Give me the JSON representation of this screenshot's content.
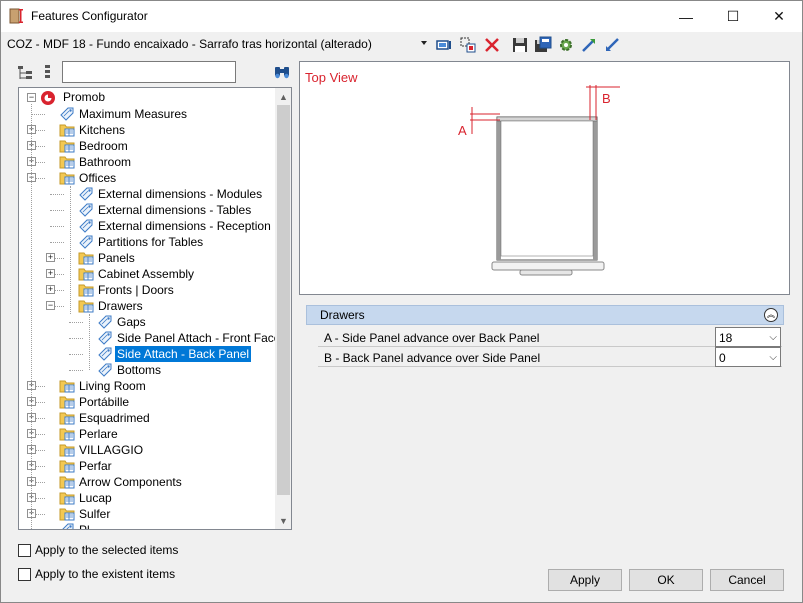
{
  "window": {
    "title": "Features Configurator",
    "minimize_glyph": "—",
    "maximize_glyph": "☐",
    "close_glyph": "✕"
  },
  "toolbar": {
    "config_value": "COZ - MDF 18 - Fundo encaixado - Sarrafo tras horizontal (alterado)",
    "icons": [
      "select-screen-icon",
      "select-item-icon",
      "delete-icon",
      "save-icon",
      "save-as-icon",
      "settings-icon",
      "expand-icon",
      "collapse-icon"
    ]
  },
  "search": {
    "value": "",
    "placeholder": ""
  },
  "tree": {
    "root": "Promob",
    "items": [
      {
        "label": "Maximum Measures"
      },
      {
        "label": "Kitchens"
      },
      {
        "label": "Bedroom"
      },
      {
        "label": "Bathroom"
      },
      {
        "label": "Offices"
      },
      {
        "label": "External dimensions - Modules"
      },
      {
        "label": "External dimensions - Tables"
      },
      {
        "label": "External dimensions - Reception"
      },
      {
        "label": "Partitions for Tables"
      },
      {
        "label": "Panels"
      },
      {
        "label": "Cabinet Assembly"
      },
      {
        "label": "Fronts | Doors"
      },
      {
        "label": "Drawers"
      },
      {
        "label": "Gaps"
      },
      {
        "label": "Side Panel Attach - Front Face"
      },
      {
        "label": "Side Attach - Back Panel"
      },
      {
        "label": "Bottoms"
      },
      {
        "label": "Living Room"
      },
      {
        "label": "Portábille"
      },
      {
        "label": "Esquadrimed"
      },
      {
        "label": "Perlare"
      },
      {
        "label": "VILLAGGIO"
      },
      {
        "label": "Perfar"
      },
      {
        "label": "Arrow Components"
      },
      {
        "label": "Lucap"
      },
      {
        "label": "Sulfer"
      },
      {
        "label": "Pl..."
      }
    ],
    "selected": "Side Attach - Back Panel"
  },
  "preview": {
    "title": "Top View",
    "label_a": "A",
    "label_b": "B",
    "accent_color": "#d9232e"
  },
  "properties": {
    "group": "Drawers",
    "rows": [
      {
        "label": "A - Side Panel advance over Back Panel",
        "value": "18"
      },
      {
        "label": "B - Back Panel advance over Side Panel",
        "value": "0"
      }
    ]
  },
  "options": {
    "apply_selected": "Apply to the selected items",
    "apply_existent": "Apply to the existent items"
  },
  "buttons": {
    "apply": "Apply",
    "ok": "OK",
    "cancel": "Cancel"
  }
}
